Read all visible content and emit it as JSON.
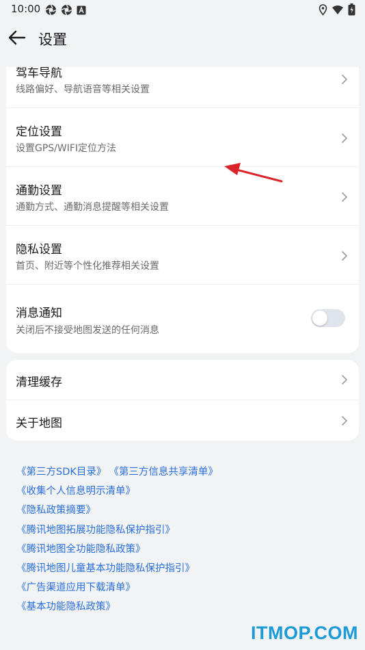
{
  "status_bar": {
    "time": "10:00",
    "left_icons": [
      "aperture-icon",
      "aperture-icon",
      "notification-a-icon"
    ],
    "right_icons": [
      "location-icon",
      "wifi-icon",
      "battery-icon"
    ]
  },
  "header": {
    "title": "设置",
    "back_icon": "back-arrow-icon"
  },
  "settings_card": {
    "items": [
      {
        "title": "驾车导航",
        "subtitle": "线路偏好、导航语音等相关设置"
      },
      {
        "title": "定位设置",
        "subtitle": "设置GPS/WIFI定位方法"
      },
      {
        "title": "通勤设置",
        "subtitle": "通勤方式、通勤消息提醒等相关设置"
      },
      {
        "title": "隐私设置",
        "subtitle": "首页、附近等个性化推荐相关设置"
      }
    ],
    "notification": {
      "title": "消息通知",
      "subtitle": "关闭后不接受地图发送的任何消息",
      "enabled": false
    }
  },
  "misc_card": {
    "items": [
      {
        "title": "清理缓存"
      },
      {
        "title": "关于地图"
      }
    ]
  },
  "links": [
    "《第三方SDK目录》",
    "《第三方信息共享清单》",
    "《收集个人信息明示清单》",
    "《隐私政策摘要》",
    "《腾讯地图拓展功能隐私保护指引》",
    "《腾讯地图全功能隐私政策》",
    "《腾讯地图儿童基本功能隐私保护指引》",
    "《广告渠道应用下载清单》",
    "《基本功能隐私政策》"
  ],
  "watermark": "ITMOP.COM",
  "colors": {
    "link": "#2a6fdb",
    "annotation_arrow": "#d9252a",
    "watermark": "#1a9ad6"
  }
}
